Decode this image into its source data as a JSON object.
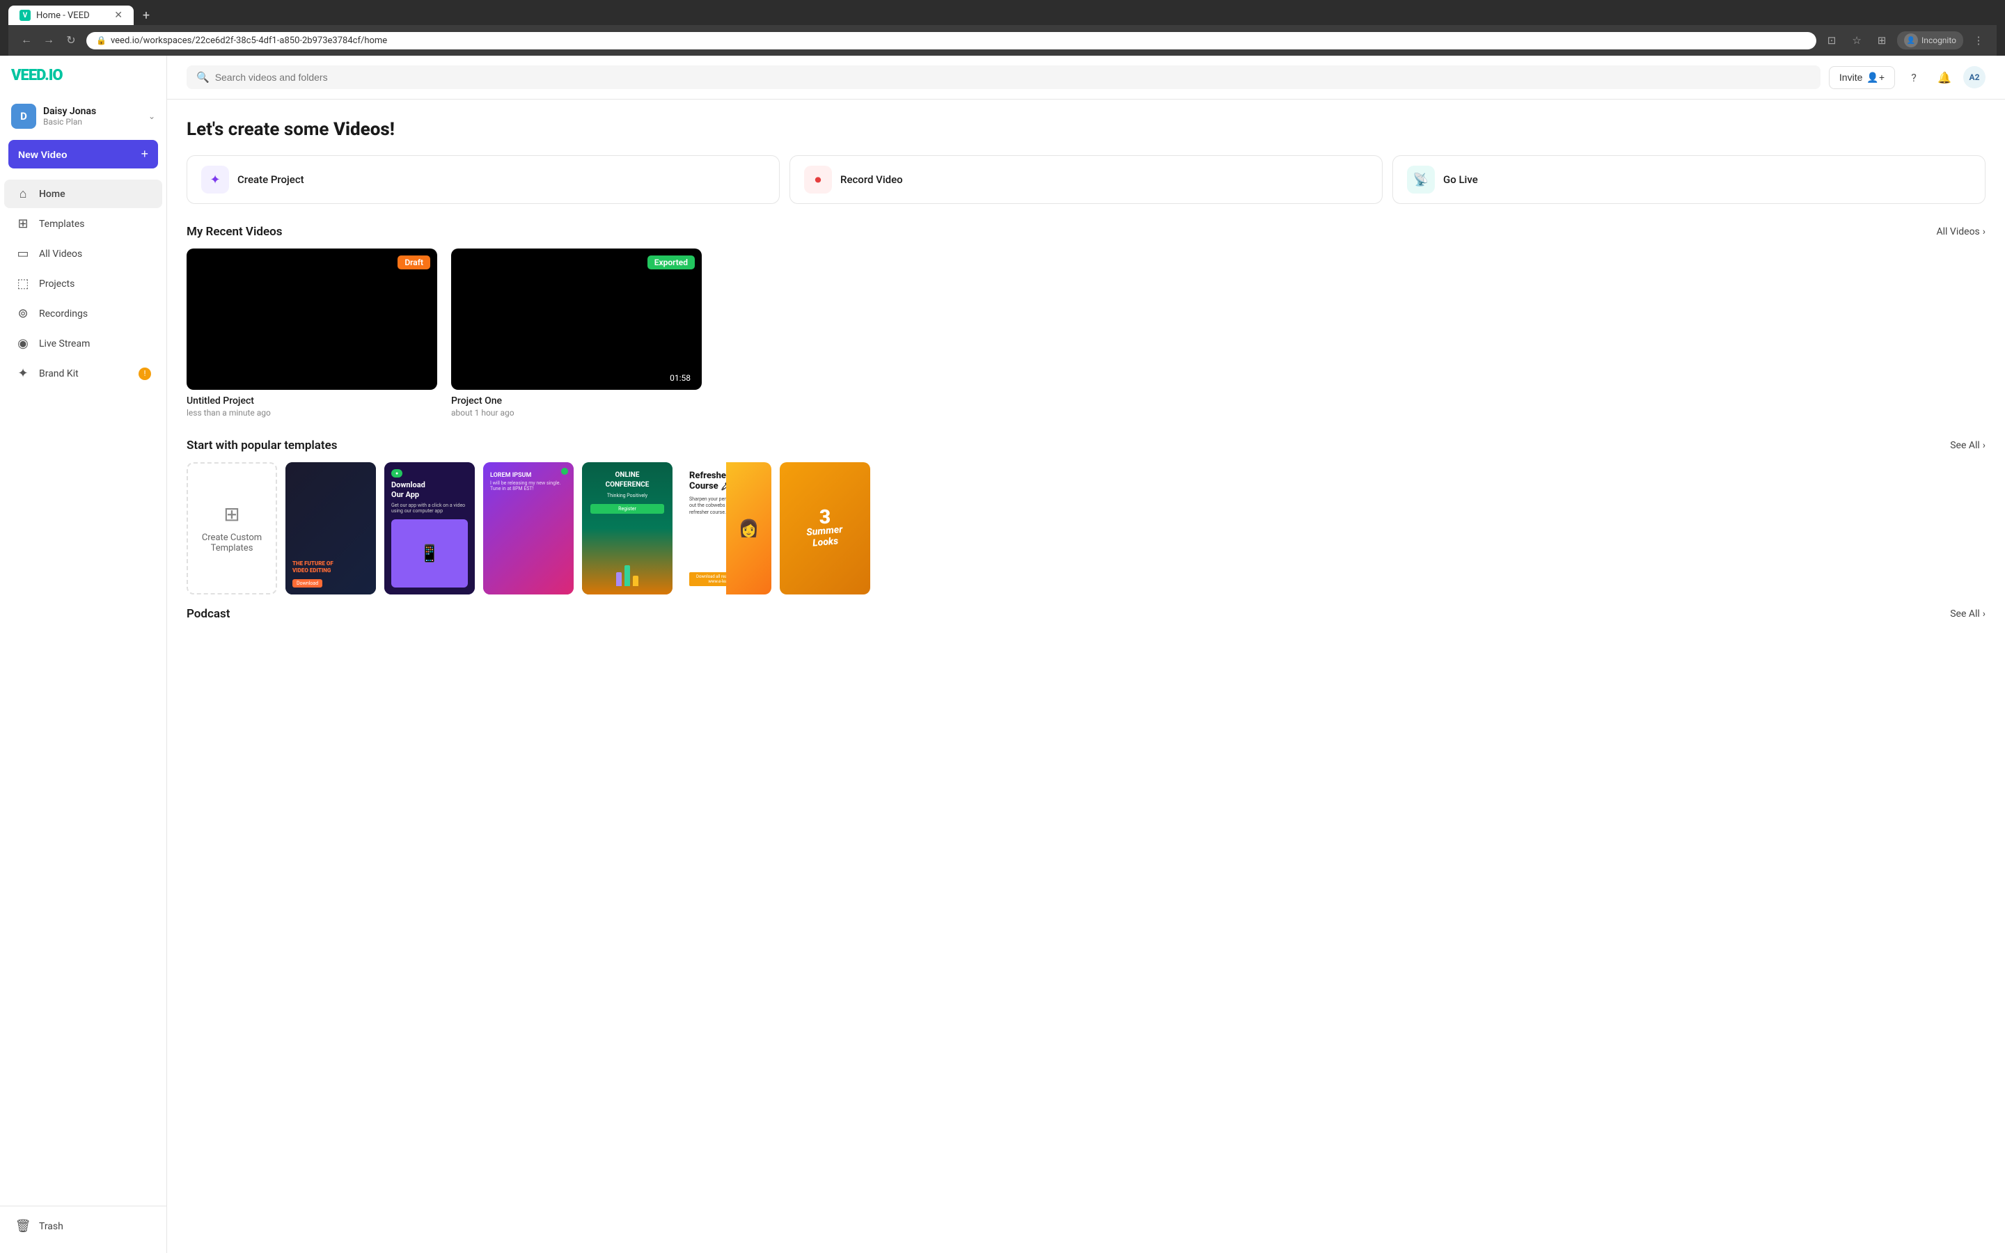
{
  "browser": {
    "tab_title": "Home - VEED",
    "tab_icon": "V",
    "new_tab_label": "+",
    "url": "veed.io/workspaces/22ce6d2f-38c5-4df1-a850-2b973e3784cf/home",
    "incognito_label": "Incognito"
  },
  "sidebar": {
    "logo_text": "VEED.IO",
    "user": {
      "avatar_letter": "D",
      "name": "Daisy Jonas",
      "plan": "Basic Plan"
    },
    "new_video_label": "New Video",
    "new_video_plus": "+",
    "nav_items": [
      {
        "id": "home",
        "label": "Home",
        "icon": "⌂",
        "active": true
      },
      {
        "id": "templates",
        "label": "Templates",
        "icon": "⊞"
      },
      {
        "id": "all-videos",
        "label": "All Videos",
        "icon": "▭"
      },
      {
        "id": "projects",
        "label": "Projects",
        "icon": "⬚"
      },
      {
        "id": "recordings",
        "label": "Recordings",
        "icon": "⊚"
      },
      {
        "id": "live-stream",
        "label": "Live Stream",
        "icon": "◉"
      },
      {
        "id": "brand-kit",
        "label": "Brand Kit",
        "icon": "✦",
        "badge": "!"
      }
    ],
    "trash_label": "Trash",
    "trash_icon": "🗑"
  },
  "topbar": {
    "search_placeholder": "Search videos and folders",
    "invite_label": "Invite",
    "user_initials": "A2"
  },
  "main": {
    "page_title_prefix": "Let's create some ",
    "page_title_highlight": "Videos!",
    "action_cards": [
      {
        "id": "create-project",
        "label": "Create Project",
        "icon": "✦",
        "icon_class": "icon-purple"
      },
      {
        "id": "record-video",
        "label": "Record Video",
        "icon": "⏺",
        "icon_class": "icon-red"
      },
      {
        "id": "go-live",
        "label": "Go Live",
        "icon": "📡",
        "icon_class": "icon-teal"
      }
    ],
    "recent_videos_title": "My Recent Videos",
    "all_videos_label": "All Videos",
    "videos": [
      {
        "id": "v1",
        "title": "Untitled Project",
        "time": "less than a minute ago",
        "badge": "Draft",
        "badge_class": "badge-draft",
        "duration": null
      },
      {
        "id": "v2",
        "title": "Project One",
        "time": "about 1 hour ago",
        "badge": "Exported",
        "badge_class": "badge-exported",
        "duration": "01:58"
      }
    ],
    "templates_section_title": "Start with popular templates",
    "see_all_label": "See All",
    "templates": [
      {
        "id": "create-custom",
        "label": "Create Custom Templates",
        "type": "create"
      },
      {
        "id": "t1",
        "label": "The Future of Video Editing",
        "type": "dark-gradient"
      },
      {
        "id": "t2",
        "label": "Download Our App",
        "type": "purple-dark"
      },
      {
        "id": "t3",
        "label": "Lorem Ipsum",
        "type": "vivid-gradient"
      },
      {
        "id": "t4",
        "label": "Online Conference",
        "type": "green-orange"
      },
      {
        "id": "t5",
        "label": "Refresher Course",
        "type": "white-card"
      },
      {
        "id": "t6",
        "label": "Summer Looks",
        "type": "photo"
      }
    ],
    "podcast_title": "Podcast",
    "podcast_see_all": "See All"
  }
}
